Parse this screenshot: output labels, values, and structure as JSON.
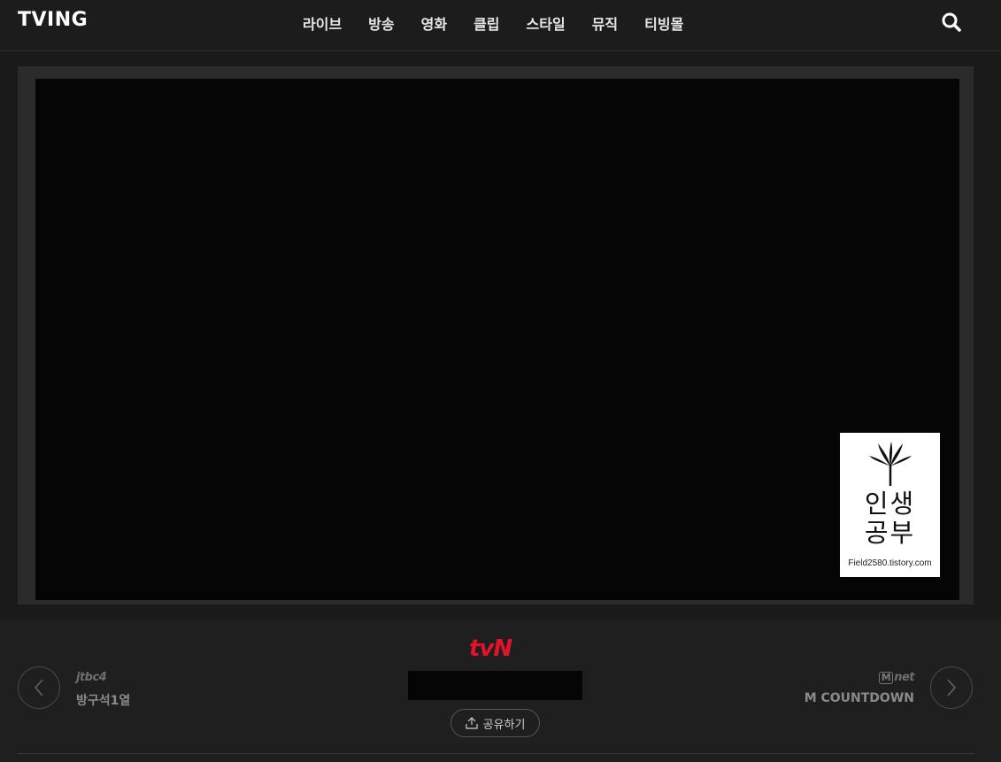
{
  "header": {
    "logo": "TVING",
    "nav": [
      "라이브",
      "방송",
      "영화",
      "클립",
      "스타일",
      "뮤직",
      "티빙몰"
    ],
    "search_icon": "search-icon"
  },
  "player": {
    "watermark": {
      "title": "인생\n공부",
      "url": "Field2580.tistory.com"
    }
  },
  "info": {
    "channel": "tvN",
    "share_label": "공유하기",
    "prev": {
      "channel": "jtbc4",
      "program": "방구석1열"
    },
    "next": {
      "channel_badge": "M",
      "channel": "net",
      "program": "M COUNTDOWN"
    }
  },
  "colors": {
    "brand": "#e4132b",
    "background": "#1a1a1a"
  }
}
